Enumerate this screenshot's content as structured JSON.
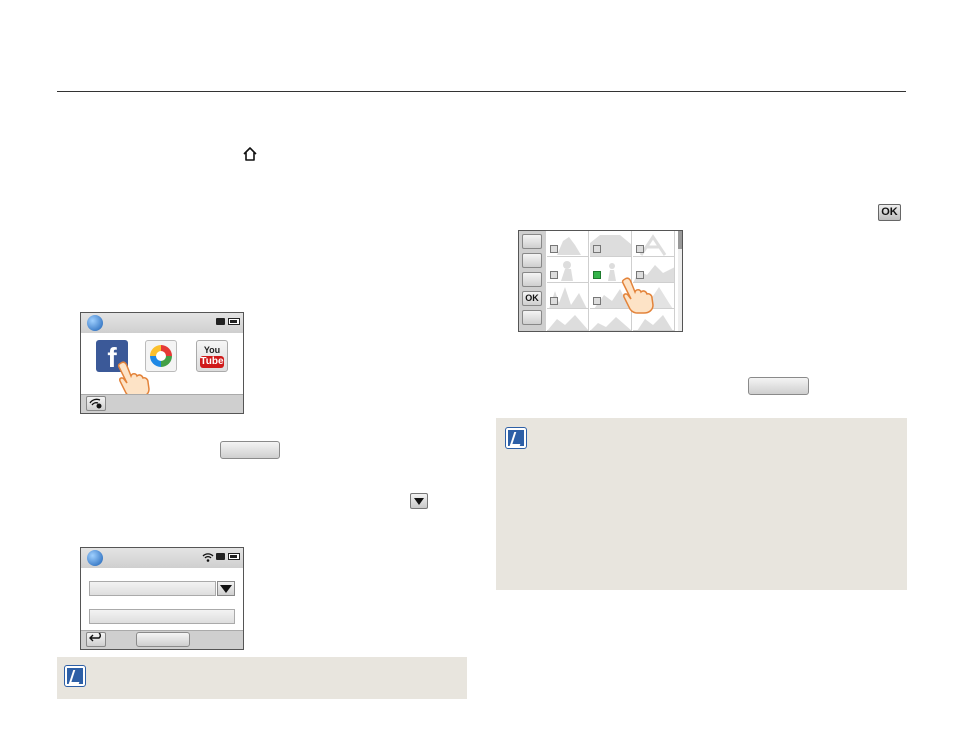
{
  "left_column": {
    "screen1": {
      "apps": [
        {
          "name": "Facebook",
          "label": "f"
        },
        {
          "name": "Picasa",
          "label": ""
        },
        {
          "name": "YouTube",
          "label_top": "You",
          "label_bottom": "Tube"
        }
      ]
    },
    "screen2": {
      "field1_value": "",
      "field2_value": "",
      "bottom_button_label": ""
    },
    "inline_button_label": ""
  },
  "right_column": {
    "ok_chip_label": "OK",
    "gallery": {
      "side_buttons": [
        "",
        "",
        "",
        "OK",
        ""
      ],
      "checked_index": 4
    },
    "inline_button_label": ""
  },
  "colors": {
    "note_bg": "#e8e5de",
    "note_icon": "#2d5fa6",
    "facebook_blue": "#3b5998",
    "youtube_red": "#d01a1a",
    "checkbox_green": "#35b34a"
  }
}
